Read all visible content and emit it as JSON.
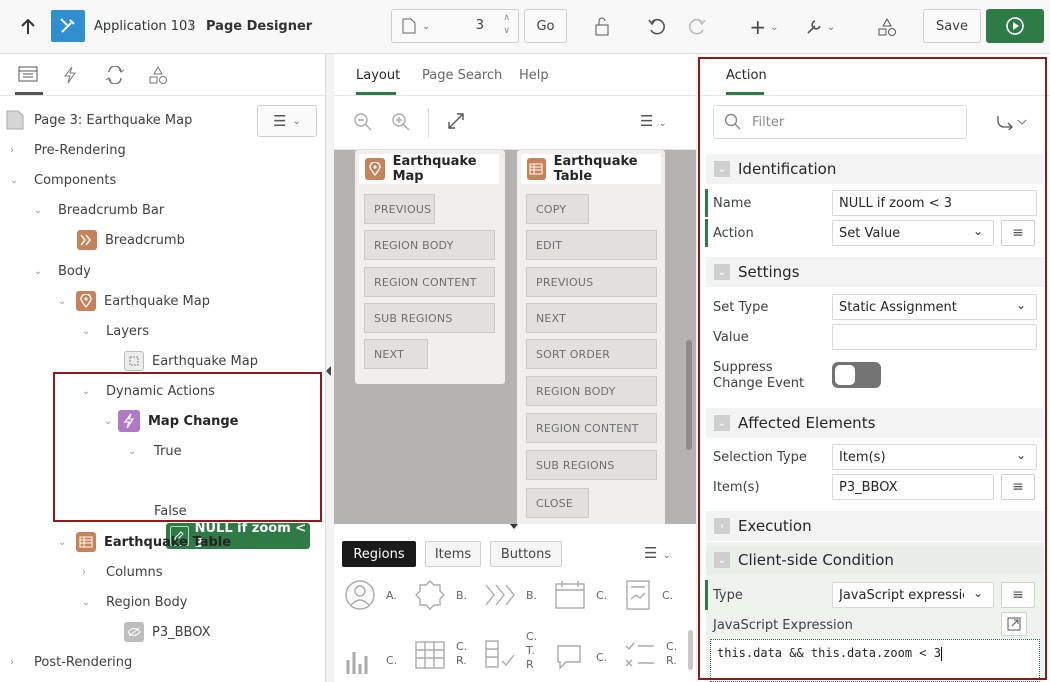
{
  "header": {
    "app_name": "Application 103",
    "separator": "\\",
    "page_title": "Page Designer",
    "page_number": "3",
    "go_label": "Go",
    "save_label": "Save"
  },
  "left": {
    "page_node": "Page 3: Earthquake Map",
    "tree": {
      "pre_rendering": "Pre-Rendering",
      "components": "Components",
      "breadcrumb_bar": "Breadcrumb Bar",
      "breadcrumb": "Breadcrumb",
      "body": "Body",
      "earthquake_map_region": "Earthquake Map",
      "layers": "Layers",
      "earthquake_map_layer": "Earthquake Map",
      "dynamic_actions": "Dynamic Actions",
      "map_change": "Map Change",
      "true_label": "True",
      "selected_action": "NULL if zoom < 3",
      "false_label": "False",
      "earthquake_table": "Earthquake Table",
      "columns": "Columns",
      "region_body": "Region Body",
      "p3_bbox": "P3_BBOX",
      "post_rendering": "Post-Rendering"
    }
  },
  "middle": {
    "tabs": [
      "Layout",
      "Page Search",
      "Help"
    ],
    "map_card": {
      "title": "Earthquake Map",
      "slots": [
        "PREVIOUS",
        "REGION BODY",
        "REGION CONTENT",
        "SUB REGIONS",
        "NEXT"
      ]
    },
    "table_card": {
      "title": "Earthquake Table",
      "slots": [
        "COPY",
        "EDIT",
        "PREVIOUS",
        "NEXT",
        "SORT ORDER",
        "REGION BODY",
        "REGION CONTENT",
        "SUB REGIONS",
        "CLOSE"
      ]
    },
    "gallery_tabs": [
      "Regions",
      "Items",
      "Buttons"
    ],
    "gallery_labels": [
      "A.",
      "B.",
      "B.",
      "C.",
      "C.",
      "C.",
      "C.\nR.",
      "C.\nT.\nR",
      "C.",
      "C.\nR."
    ]
  },
  "right": {
    "tab": "Action",
    "filter_placeholder": "Filter",
    "sections": {
      "identification": "Identification",
      "settings": "Settings",
      "affected": "Affected Elements",
      "execution": "Execution",
      "client_condition": "Client-side Condition"
    },
    "props": {
      "name_label": "Name",
      "name_value": "NULL if zoom < 3",
      "action_label": "Action",
      "action_value": "Set Value",
      "set_type_label": "Set Type",
      "set_type_value": "Static Assignment",
      "value_label": "Value",
      "value_value": "",
      "suppress_label": "Suppress Change Event",
      "selection_type_label": "Selection Type",
      "selection_type_value": "Item(s)",
      "items_label": "Item(s)",
      "items_value": "P3_BBOX",
      "type_label": "Type",
      "type_value": "JavaScript expression",
      "js_label": "JavaScript Expression",
      "js_value": "this.data && this.data.zoom < 3"
    },
    "suppress_toggle_on": false
  },
  "colors": {
    "primary_green": "#2e7b46",
    "highlight_red": "#8b1a1a",
    "app_blue": "#2f8fcf",
    "region_orange": "#c8825a",
    "da_purple": "#b07ac4"
  }
}
